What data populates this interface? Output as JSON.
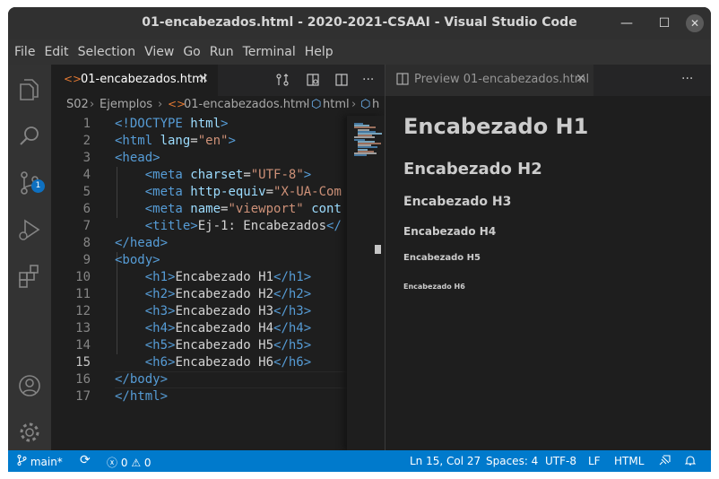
{
  "window": {
    "title": "01-encabezados.html - 2020-2021-CSAAI - Visual Studio Code",
    "minimize": "—",
    "maximize": "☐",
    "close": "✕"
  },
  "menu": [
    "File",
    "Edit",
    "Selection",
    "View",
    "Go",
    "Run",
    "Terminal",
    "Help"
  ],
  "activity_bar": {
    "icons": [
      "explorer-icon",
      "search-icon",
      "source-control-icon",
      "run-debug-icon",
      "extensions-icon",
      "account-icon",
      "settings-gear-icon"
    ],
    "scm_badge": "1"
  },
  "editor": {
    "tab": {
      "icon": "<>",
      "label": "01-encabezados.html",
      "close": "✕"
    },
    "tab_actions": {
      "more": "···"
    },
    "breadcrumb": [
      "S02",
      "Ejemplos",
      "01-encabezados.html",
      "html",
      "h"
    ],
    "lines": [
      {
        "n": "1",
        "segments": [
          [
            "tag",
            "<!DOCTYPE "
          ],
          [
            "attr",
            "html"
          ],
          [
            "tag",
            ">"
          ]
        ]
      },
      {
        "n": "2",
        "segments": [
          [
            "tag",
            "<html "
          ],
          [
            "attr",
            "lang"
          ],
          [
            "txt",
            "="
          ],
          [
            "str",
            "\"en\""
          ],
          [
            "tag",
            ">"
          ]
        ]
      },
      {
        "n": "3",
        "segments": [
          [
            "tag",
            "<head>"
          ]
        ]
      },
      {
        "n": "4",
        "segments": [
          [
            "txt",
            "    "
          ],
          [
            "tag",
            "<meta "
          ],
          [
            "attr",
            "charset"
          ],
          [
            "txt",
            "="
          ],
          [
            "str",
            "\"UTF-8\""
          ],
          [
            "tag",
            ">"
          ]
        ]
      },
      {
        "n": "5",
        "segments": [
          [
            "txt",
            "    "
          ],
          [
            "tag",
            "<meta "
          ],
          [
            "attr",
            "http-equiv"
          ],
          [
            "txt",
            "="
          ],
          [
            "str",
            "\"X-UA-Com"
          ]
        ]
      },
      {
        "n": "6",
        "segments": [
          [
            "txt",
            "    "
          ],
          [
            "tag",
            "<meta "
          ],
          [
            "attr",
            "name"
          ],
          [
            "txt",
            "="
          ],
          [
            "str",
            "\"viewport\""
          ],
          [
            "txt",
            " "
          ],
          [
            "attr",
            "cont"
          ]
        ]
      },
      {
        "n": "7",
        "segments": [
          [
            "txt",
            "    "
          ],
          [
            "tag",
            "<title>"
          ],
          [
            "txt",
            "Ej-1: Encabezados"
          ],
          [
            "tag",
            "</"
          ]
        ]
      },
      {
        "n": "8",
        "segments": [
          [
            "tag",
            "</head>"
          ]
        ]
      },
      {
        "n": "9",
        "segments": [
          [
            "tag",
            "<body>"
          ]
        ]
      },
      {
        "n": "10",
        "segments": [
          [
            "txt",
            "    "
          ],
          [
            "tag",
            "<h1>"
          ],
          [
            "txt",
            "Encabezado H1"
          ],
          [
            "tag",
            "</h1>"
          ]
        ]
      },
      {
        "n": "11",
        "segments": [
          [
            "txt",
            "    "
          ],
          [
            "tag",
            "<h2>"
          ],
          [
            "txt",
            "Encabezado H2"
          ],
          [
            "tag",
            "</h2>"
          ]
        ]
      },
      {
        "n": "12",
        "segments": [
          [
            "txt",
            "    "
          ],
          [
            "tag",
            "<h3>"
          ],
          [
            "txt",
            "Encabezado H3"
          ],
          [
            "tag",
            "</h3>"
          ]
        ]
      },
      {
        "n": "13",
        "segments": [
          [
            "txt",
            "    "
          ],
          [
            "tag",
            "<h4>"
          ],
          [
            "txt",
            "Encabezado H4"
          ],
          [
            "tag",
            "</h4>"
          ]
        ]
      },
      {
        "n": "14",
        "segments": [
          [
            "txt",
            "    "
          ],
          [
            "tag",
            "<h5>"
          ],
          [
            "txt",
            "Encabezado H5"
          ],
          [
            "tag",
            "</h5>"
          ]
        ]
      },
      {
        "n": "15",
        "segments": [
          [
            "txt",
            "    "
          ],
          [
            "tag",
            "<h6>"
          ],
          [
            "txt",
            "Encabezado H6"
          ],
          [
            "tag",
            "</h6>"
          ]
        ]
      },
      {
        "n": "16",
        "segments": [
          [
            "tag",
            "</body>"
          ]
        ]
      },
      {
        "n": "17",
        "segments": [
          [
            "tag",
            "</html>"
          ]
        ]
      }
    ],
    "active_line": "15"
  },
  "preview": {
    "tab": {
      "label": "Preview 01-encabezados.html",
      "close": "✕"
    },
    "more": "···",
    "headings": [
      "Encabezado H1",
      "Encabezado H2",
      "Encabezado H3",
      "Encabezado H4",
      "Encabezado H5",
      "Encabezado H6"
    ]
  },
  "status": {
    "branch": "main*",
    "sync_icon": "⟳",
    "errors": "0",
    "warnings": "0",
    "position": "Ln 15, Col 27",
    "spaces": "Spaces: 4",
    "encoding": "UTF-8",
    "eol": "LF",
    "language": "HTML"
  },
  "colors": {
    "accent": "#007acc",
    "editor_bg": "#1e1e1e",
    "tag": "#569cd6",
    "attribute": "#9cdcfe",
    "string": "#ce9178",
    "html_file_icon": "#e37933"
  }
}
